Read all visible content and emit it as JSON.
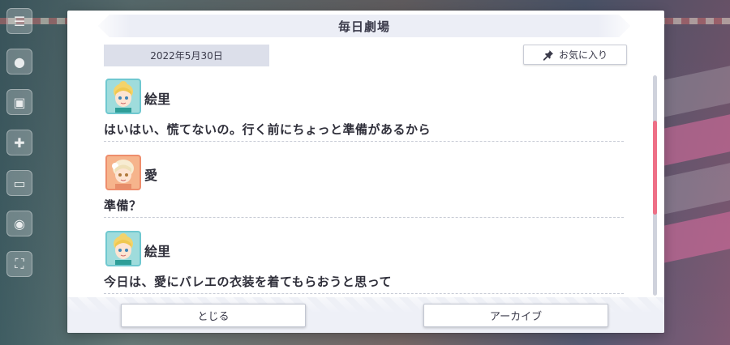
{
  "dialog": {
    "title": "毎日劇場",
    "date": "2022年5月30日",
    "favorite_label": "お気に入り"
  },
  "messages": [
    {
      "speaker": "絵里",
      "avatar": "eli-avatar",
      "text": "はいはい、慌てないの。行く前にちょっと準備があるから"
    },
    {
      "speaker": "愛",
      "avatar": "ai-avatar",
      "text": "準備？"
    },
    {
      "speaker": "絵里",
      "avatar": "eli-avatar",
      "text": "今日は、愛にバレエの衣装を着てもらおうと思って"
    }
  ],
  "buttons": {
    "close_label": "とじる",
    "archive_label": "アーカイブ"
  },
  "icons": {
    "favorite": "pin-icon"
  },
  "colors": {
    "accent_scroll": "#ee6f86",
    "title_bg": "#eceef6",
    "date_bg": "#dcdfea"
  }
}
